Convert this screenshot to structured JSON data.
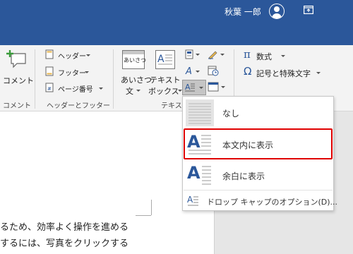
{
  "titlebar": {
    "user_name": "秋葉 一郎",
    "bg_color": "#2b579a",
    "avatar_icon": "user-avatar-icon",
    "display_options_icon": "ribbon-display-options-icon"
  },
  "ribbon": {
    "comments_group": {
      "comment_button": "コメント",
      "label": "コメント"
    },
    "header_footer_group": {
      "header": "ヘッダー",
      "footer": "フッター",
      "page_number": "ページ番号",
      "label": "ヘッダーとフッター"
    },
    "text_group": {
      "greeting_button_line1": "あいさつ",
      "greeting_button_line2": "文",
      "greeting_icon_text": "あいさつ",
      "textbox_button_line1": "テキスト",
      "textbox_button_line2": "ボックス",
      "label": "テキス"
    },
    "symbols_group": {
      "equation": "数式",
      "symbol": "記号と特殊文字",
      "equation_icon_text": "π",
      "symbol_icon_text": "Ω"
    }
  },
  "document": {
    "lines": [
      "るため、効率よく操作を進める",
      "するには、写真をクリックする"
    ]
  },
  "dropcap_menu": {
    "items": [
      {
        "label": "なし"
      },
      {
        "label": "本文内に表示"
      },
      {
        "label": "余白に表示"
      }
    ],
    "options": "ドロップ キャップのオプション(D)...",
    "dropcap_letter": "A",
    "highlight_color": "#e00000",
    "accent_color": "#2b579a"
  }
}
